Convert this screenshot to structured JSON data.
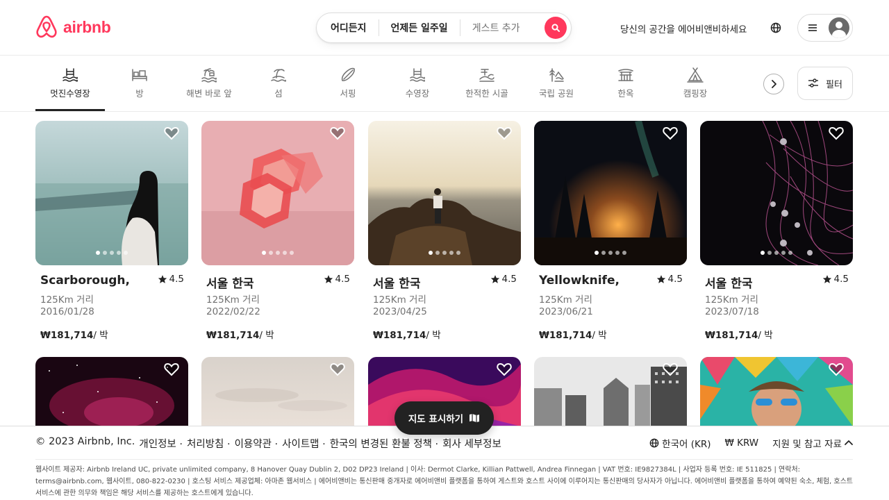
{
  "header": {
    "logo_text": "airbnb",
    "search": {
      "anywhere": "어디든지",
      "anyweek": "언제든 일주일",
      "guests": "게스트 추가"
    },
    "host_link": "당신의 공간을 에어비앤비하세요"
  },
  "categories": [
    {
      "label": "멋진수영장",
      "icon": "pool-icon",
      "active": true
    },
    {
      "label": "방",
      "icon": "bed-icon"
    },
    {
      "label": "해변 바로 앞",
      "icon": "beach-icon"
    },
    {
      "label": "섬",
      "icon": "island-icon"
    },
    {
      "label": "서핑",
      "icon": "surfboard-icon"
    },
    {
      "label": "수영장",
      "icon": "pool-icon"
    },
    {
      "label": "한적한 시골",
      "icon": "countryside-icon"
    },
    {
      "label": "국립 공원",
      "icon": "national-park-icon"
    },
    {
      "label": "한옥",
      "icon": "hanok-icon"
    },
    {
      "label": "캠핑장",
      "icon": "camping-icon"
    }
  ],
  "filter_label": "필터",
  "listings": [
    {
      "title": "Scarborough,",
      "rating": "4.5",
      "distance": "125Km 거리",
      "date": "2016/01/28",
      "price": "₩181,714",
      "unit": "/ 박"
    },
    {
      "title": "서울 한국",
      "rating": "4.5",
      "distance": "125Km 거리",
      "date": "2022/02/22",
      "price": "₩181,714",
      "unit": "/ 박"
    },
    {
      "title": "서울 한국",
      "rating": "4.5",
      "distance": "125Km 거리",
      "date": "2023/04/25",
      "price": "₩181,714",
      "unit": "/ 박"
    },
    {
      "title": "Yellowknife,",
      "rating": "4.5",
      "distance": "125Km 거리",
      "date": "2023/06/21",
      "price": "₩181,714",
      "unit": "/ 박"
    },
    {
      "title": "서울 한국",
      "rating": "4.5",
      "distance": "125Km 거리",
      "date": "2023/07/18",
      "price": "₩181,714",
      "unit": "/ 박"
    }
  ],
  "map_button": "지도 표시하기",
  "footer": {
    "copyright": "© 2023 Airbnb, Inc.",
    "links": [
      "개인정보 ·",
      "처리방침 ·",
      "이용약관 ·",
      "사이트맵 ·",
      "한국의 변경된 환불 정책 ·",
      "회사 세부정보"
    ],
    "language": "한국어 (KR)",
    "currency": "₩ KRW",
    "support": "지원 및 참고 자료",
    "legal": "웹사이트 제공자: Airbnb Ireland UC, private unlimited company, 8 Hanover Quay Dublin 2, D02 DP23 Ireland | 이사: Dermot Clarke, Killian Pattwell, Andrea Finnegan | VAT 번호: IE9827384L | 사업자 등록 번호: IE 511825 | 연락처: terms@airbnb.com, 웹사이트, 080-822-0230 | 호스팅 서비스 제공업체: 아마존 웹서비스 | 에어비앤비는 통신판매 중개자로 에어비앤비 플랫폼을 통하여 게스트와 호스트 사이에 이루어지는 통신판매의 당사자가 아닙니다. 에어비앤비 플랫폼을 통하여 예약된 숙소, 체험, 호스트 서비스에 관한 의무와 책임은 해당 서비스를 제공하는 호스트에게 있습니다."
  },
  "colors": {
    "brand": "#ff385c",
    "text": "#222222",
    "muted": "#717171"
  }
}
